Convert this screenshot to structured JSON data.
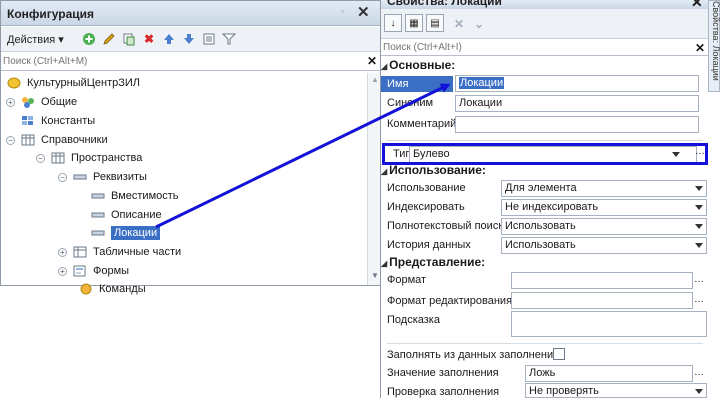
{
  "config": {
    "title": "Конфигурация",
    "actions_label": "Действия",
    "search_placeholder": "Поиск (Ctrl+Alt+M)",
    "tree": [
      {
        "label": "КультурныйЦентрЗИЛ"
      },
      {
        "label": "Общие"
      },
      {
        "label": "Константы"
      },
      {
        "label": "Справочники"
      },
      {
        "label": "Пространства"
      },
      {
        "label": "Реквизиты"
      },
      {
        "label": "Вместимость"
      },
      {
        "label": "Описание"
      },
      {
        "label": "Локации",
        "selected": true
      },
      {
        "label": "Табличные части"
      },
      {
        "label": "Формы"
      },
      {
        "label": "Команды"
      }
    ]
  },
  "props": {
    "title": "Свойства: Локации",
    "side_tab": "Свойства: Локации",
    "search_placeholder": "Поиск (Ctrl+Alt+I)",
    "sections": {
      "main": "Основные:",
      "usage": "Использование:",
      "view": "Представление:"
    },
    "fields": {
      "name_label": "Имя",
      "name_value": "Локации",
      "synonym_label": "Синоним",
      "synonym_value": "Локации",
      "comment_label": "Комментарий",
      "comment_value": "",
      "type_label": "Тип",
      "type_value": "Булево",
      "usage_label": "Использование",
      "usage_value": "Для элемента",
      "index_label": "Индексировать",
      "index_value": "Не индексировать",
      "fulltext_label": "Полнотекстовый поиск",
      "fulltext_value": "Использовать",
      "history_label": "История данных",
      "history_value": "Использовать",
      "format_label": "Формат",
      "format_value": "",
      "edit_format_label": "Формат редактирования",
      "edit_format_value": "",
      "hint_label": "Подсказка",
      "hint_value": "",
      "fill_from_data_label": "Заполнять из данных заполнения",
      "fill_value_label": "Значение заполнения",
      "fill_value": "Ложь",
      "fill_check_label": "Проверка заполнения",
      "fill_check_value": "Не проверять"
    }
  },
  "colors": {
    "highlight": "#1212d8",
    "selection": "#3b6fc6",
    "window_frame": "#8e9aa8"
  },
  "icons": {
    "add": "plus-circle-icon",
    "edit": "pencil-icon",
    "copy": "copy-icon",
    "delete": "delete-icon",
    "move_up": "arrow-up-icon",
    "move_down": "arrow-down-icon",
    "list": "list-icon",
    "filter": "filter-icon"
  }
}
